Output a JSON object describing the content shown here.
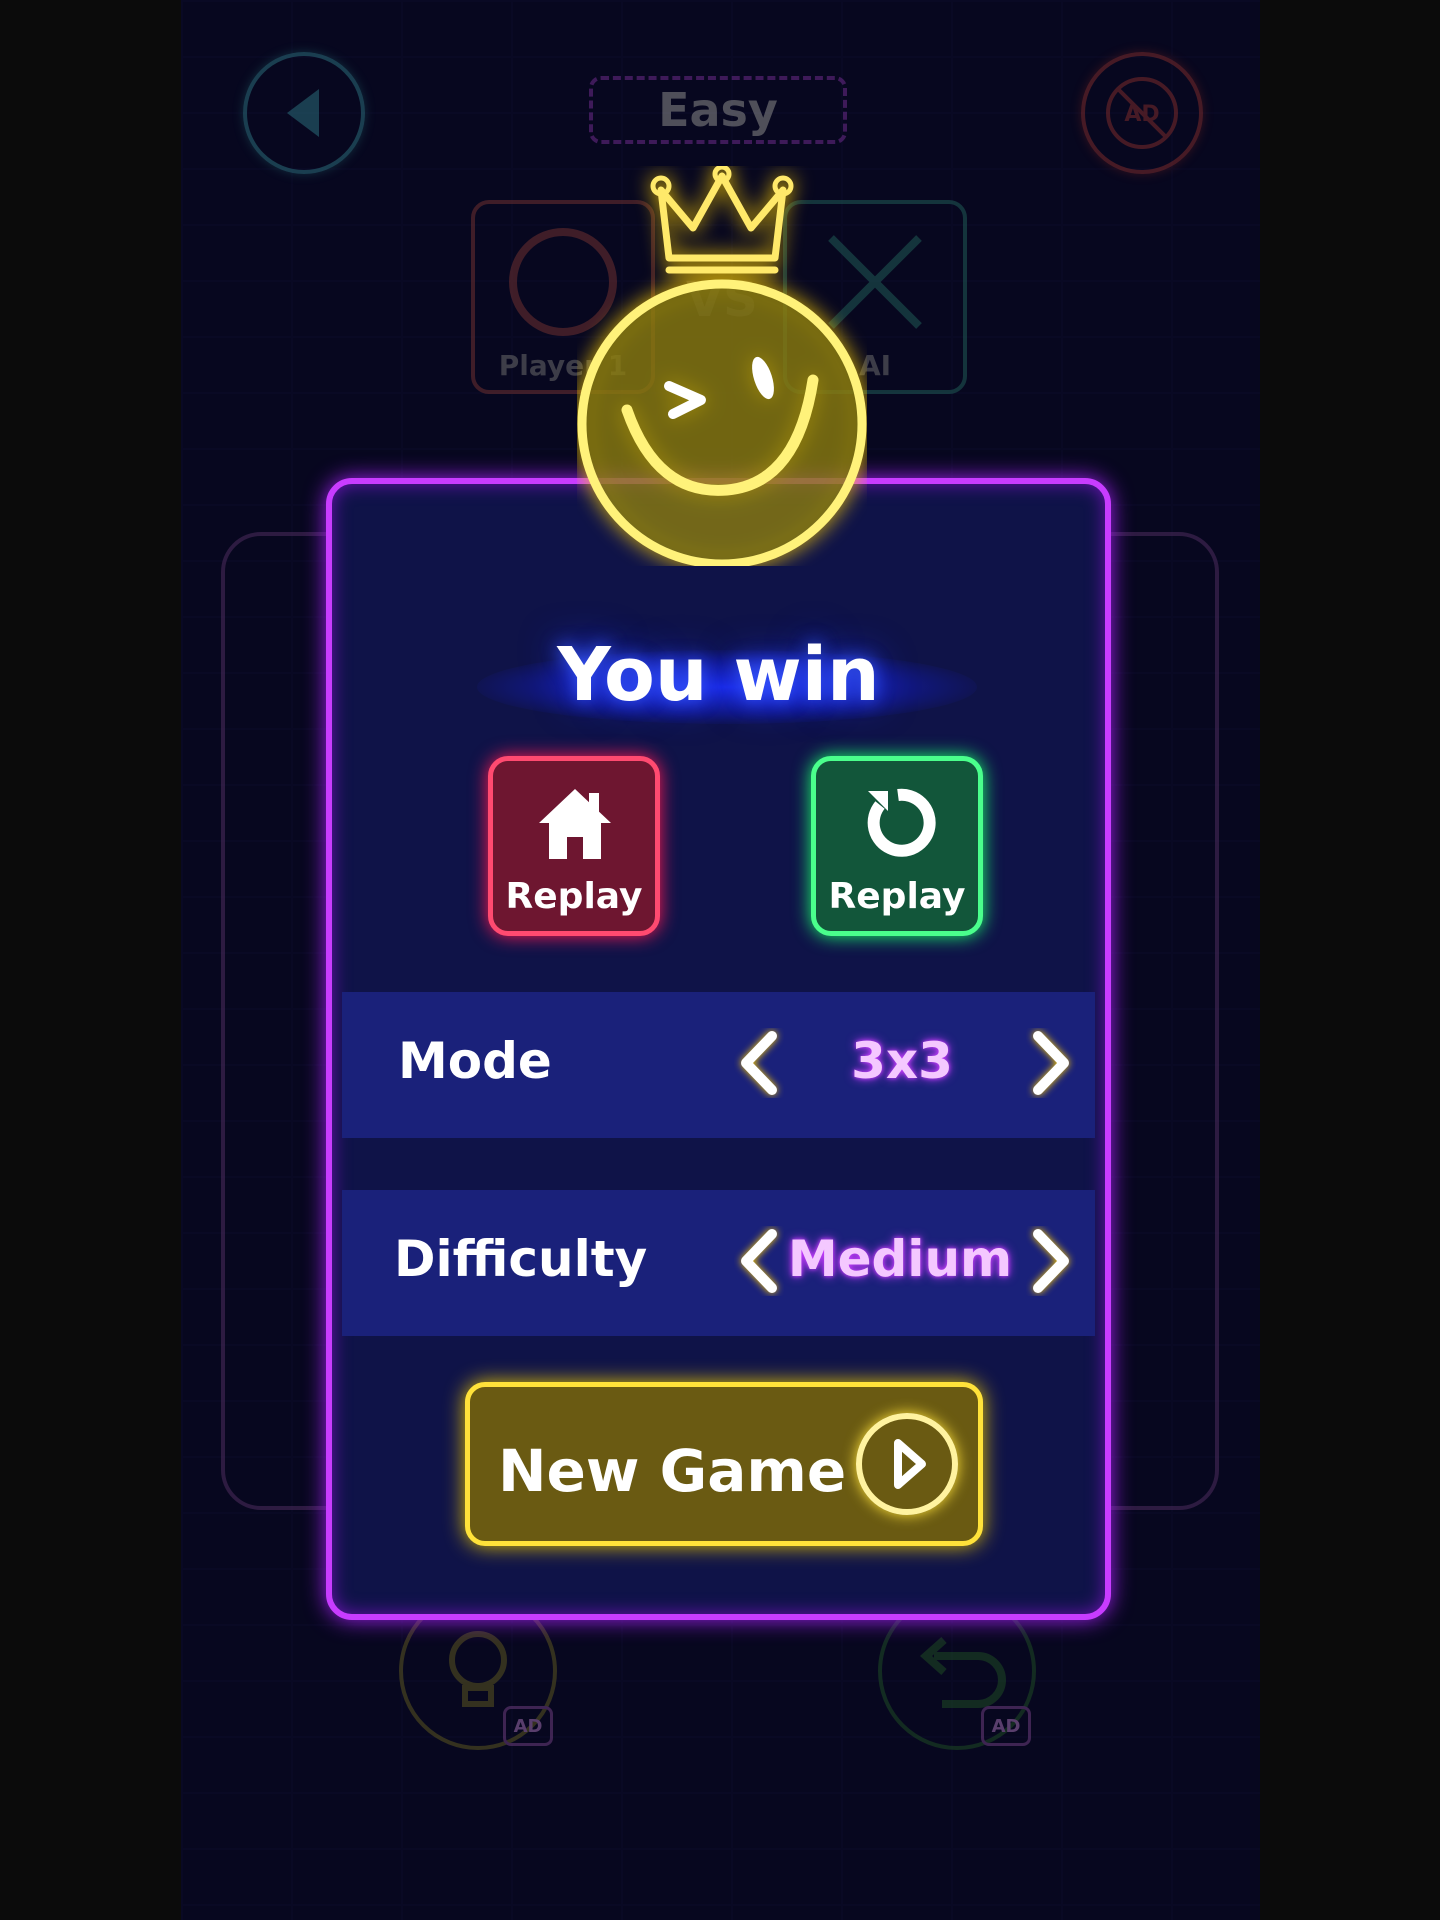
{
  "header": {
    "level": "Easy",
    "no_ads_label": "AD"
  },
  "players": {
    "left": "Player 1",
    "right": "AI",
    "vs": "VS"
  },
  "tools": {
    "hint_ad": "AD",
    "undo_ad": "AD"
  },
  "dialog": {
    "title": "You win",
    "home_label": "Replay",
    "replay_label": "Replay",
    "mode": {
      "label": "Mode",
      "value": "3x3"
    },
    "difficulty": {
      "label": "Difficulty",
      "value": "Medium"
    },
    "new_game_label": "New Game"
  },
  "colors": {
    "dialog_border": "#c83cff",
    "title_glow": "#3a5cff",
    "home": "#ff4a70",
    "replay": "#4aff8c",
    "new_game": "#ffe23a",
    "smiley": "#ffe23a"
  }
}
